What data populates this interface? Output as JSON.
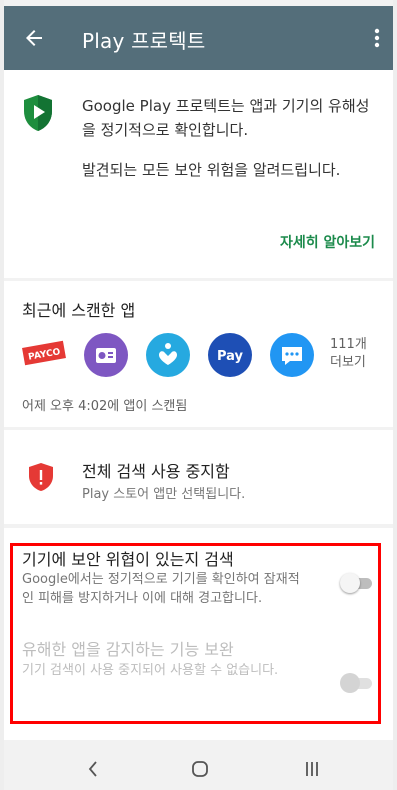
{
  "appbar": {
    "title": "Play 프로텍트",
    "back_icon": "arrow-back-icon",
    "menu_icon": "more-vert-icon",
    "color": "#546e7a"
  },
  "intro": {
    "text1": "Google Play 프로텍트는 앱과 기기의 유해성을 정기적으로 확인합니다.",
    "text2": "발견되는 모든 보안 위험을 알려드립니다.",
    "learn_more": "자세히 알아보기",
    "accent": "#1b8a4b"
  },
  "recent": {
    "title": "최근에 스캔한 앱",
    "apps": [
      {
        "icon": "payco-app-icon",
        "label": "PAYCO"
      },
      {
        "icon": "radio-app-icon"
      },
      {
        "icon": "health-app-icon"
      },
      {
        "icon": "samsung-pay-app-icon",
        "label": "Pay"
      },
      {
        "icon": "messages-app-icon"
      }
    ],
    "more_count": "111개",
    "more_label": "더보기",
    "scan_time": "어제 오후 4:02에 앱이 스캔됨"
  },
  "fullscan": {
    "title": "전체 검색 사용 중지함",
    "subtitle": "Play 스토어 앱만 선택됩니다."
  },
  "settings": {
    "scan_title": "기기에 보안 위협이 있는지 검색",
    "scan_desc": "Google에서는 정기적으로 기기를 확인하여 잠재적인 피해를 방지하거나 이에 대해 경고합니다.",
    "scan_enabled": false,
    "improve_title": "유해한 앱을 감지하는 기능 보완",
    "improve_desc": "기기 검색이 사용 중지되어 사용할 수 없습니다.",
    "improve_enabled": false
  },
  "navbar": {
    "back": "nav-back-icon",
    "home": "nav-home-icon",
    "recents": "nav-recents-icon"
  }
}
